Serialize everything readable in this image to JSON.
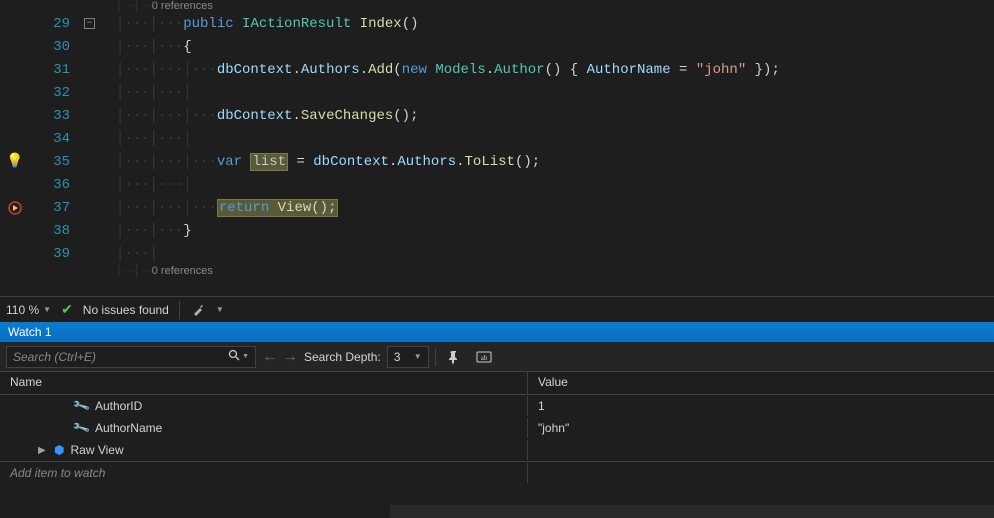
{
  "editor": {
    "codelens_text": "0 references",
    "codelens2_text": "0 references",
    "lines": {
      "29": {
        "tokens": [
          {
            "c": "kw",
            "t": "public"
          },
          {
            "c": "plain",
            "t": " "
          },
          {
            "c": "type",
            "t": "IActionResult"
          },
          {
            "c": "plain",
            "t": " "
          },
          {
            "c": "method",
            "t": "Index"
          },
          {
            "c": "plain",
            "t": "()"
          }
        ]
      },
      "30": {
        "tokens": [
          {
            "c": "plain",
            "t": "{"
          }
        ]
      },
      "31": {
        "tokens": [
          {
            "c": "field",
            "t": "dbContext"
          },
          {
            "c": "plain",
            "t": "."
          },
          {
            "c": "field",
            "t": "Authors"
          },
          {
            "c": "plain",
            "t": "."
          },
          {
            "c": "method",
            "t": "Add"
          },
          {
            "c": "plain",
            "t": "("
          },
          {
            "c": "kw",
            "t": "new"
          },
          {
            "c": "plain",
            "t": " "
          },
          {
            "c": "type",
            "t": "Models"
          },
          {
            "c": "plain",
            "t": "."
          },
          {
            "c": "type",
            "t": "Author"
          },
          {
            "c": "plain",
            "t": "() { "
          },
          {
            "c": "field",
            "t": "AuthorName"
          },
          {
            "c": "plain",
            "t": " = "
          },
          {
            "c": "str",
            "t": "\"john\""
          },
          {
            "c": "plain",
            "t": " });"
          }
        ]
      },
      "33": {
        "tokens": [
          {
            "c": "field",
            "t": "dbContext"
          },
          {
            "c": "plain",
            "t": "."
          },
          {
            "c": "method",
            "t": "SaveChanges"
          },
          {
            "c": "plain",
            "t": "();"
          }
        ]
      },
      "35": {
        "tokens_pre": [
          {
            "c": "kw",
            "t": "var"
          },
          {
            "c": "plain",
            "t": " "
          }
        ],
        "highlight": "list",
        "tokens_post": [
          {
            "c": "plain",
            "t": " = "
          },
          {
            "c": "field",
            "t": "dbContext"
          },
          {
            "c": "plain",
            "t": "."
          },
          {
            "c": "field",
            "t": "Authors"
          },
          {
            "c": "plain",
            "t": "."
          },
          {
            "c": "method",
            "t": "ToList"
          },
          {
            "c": "plain",
            "t": "();"
          }
        ]
      },
      "37": {
        "exec_tokens": [
          {
            "c": "kw",
            "t": "return"
          },
          {
            "c": "plain",
            "t": " "
          },
          {
            "c": "method",
            "t": "View"
          },
          {
            "c": "plain",
            "t": "();"
          }
        ]
      },
      "38": {
        "tokens": [
          {
            "c": "plain",
            "t": "}"
          }
        ]
      }
    }
  },
  "statusbar": {
    "zoom": "110 %",
    "issues": "No issues found"
  },
  "watch": {
    "title": "Watch 1",
    "search_placeholder": "Search (Ctrl+E)",
    "depth_label": "Search Depth:",
    "depth_value": "3",
    "cols": {
      "name": "Name",
      "value": "Value"
    },
    "rows": [
      {
        "icon": "wrench",
        "name": "AuthorID",
        "value": "1"
      },
      {
        "icon": "wrench",
        "name": "AuthorName",
        "value": "\"john\""
      }
    ],
    "raw_view_label": "Raw View",
    "add_item_label": "Add item to watch"
  }
}
